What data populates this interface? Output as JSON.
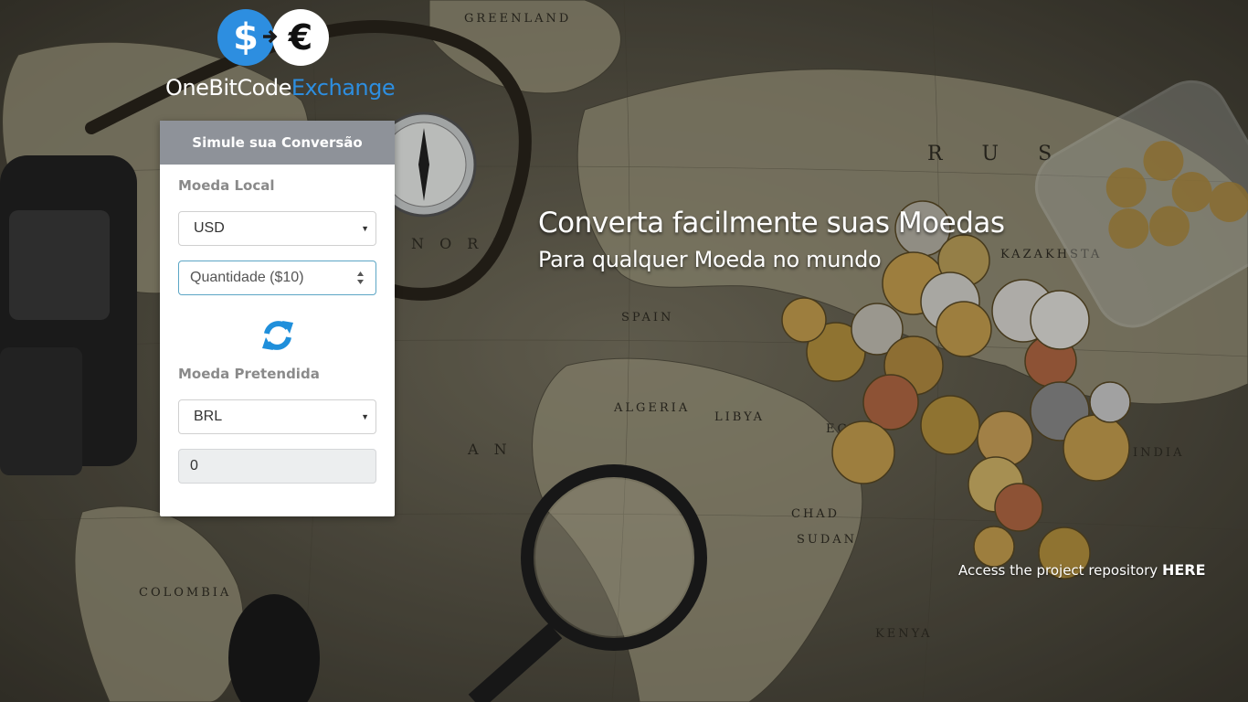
{
  "logo": {
    "dollar_glyph": "$",
    "euro_glyph": "€",
    "word_primary": "OneBitCode",
    "word_accent": "Exchange",
    "accent_color": "#2d8ee0"
  },
  "converter": {
    "title": "Simule sua Conversão",
    "local_label": "Moeda Local",
    "local_currency": "USD",
    "amount_placeholder": "Quantidade ($10)",
    "swap_icon": "refresh-icon",
    "target_label": "Moeda Pretendida",
    "target_currency": "BRL",
    "result_value": "0"
  },
  "hero": {
    "title": "Converta facilmente suas Moedas",
    "subtitle": "Para qualquer Moeda no mundo"
  },
  "footer": {
    "repo_text": "Access the project repository",
    "repo_link": "HERE"
  }
}
